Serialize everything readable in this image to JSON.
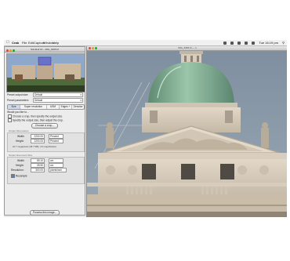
{
  "menubar": {
    "apple": "",
    "app_name": "Crab",
    "items": [
      "File",
      "Edit",
      "Capture",
      "Window",
      "Help"
    ],
    "clock": "Tue 16:19 pm"
  },
  "panel": {
    "title": "SlimRoll 16 – IMG_6365.tif",
    "preset_output_size_label": "Preset output size:",
    "preset_output_size_value": "Default",
    "preset_parameters_label": "Preset parameters:",
    "preset_parameters_value": "Default",
    "tabs": [
      "Size",
      "Super resolution",
      "USM",
      "Edges +",
      "Denoise"
    ],
    "would_you_like": "Would you like to...",
    "option1": "Choose a crop, then specify the output size.",
    "option2": "Specify the output size, then adjust the crop.",
    "choose_crop_button": "Choose a crop...",
    "output_dimensions_label": "Output Dimensions",
    "width_label": "Width:",
    "width_value": "2200.00",
    "height_label": "Height:",
    "height_value": "2200.00",
    "percent_unit": "Percent",
    "megapixels_note": "22.7 megapixels (48.7 MB), 4.6 magnification",
    "output_document_size_label": "Output Document Size",
    "doc_width_value": "59.10",
    "doc_height_value": "39.50",
    "cm_unit": "cm",
    "resolution_label": "Resolution:",
    "resolution_value": "300.00",
    "resolution_unit": "pixels/inch",
    "resample_label": "Resample",
    "process_button": "Process this image..."
  },
  "viewer": {
    "title": "IMG_6365.tif — 1"
  },
  "colors": {
    "sky": "#8b9aa9",
    "dome": "#7ea98f",
    "stone": "#d8cdbd",
    "shadow": "#9a8f83"
  }
}
